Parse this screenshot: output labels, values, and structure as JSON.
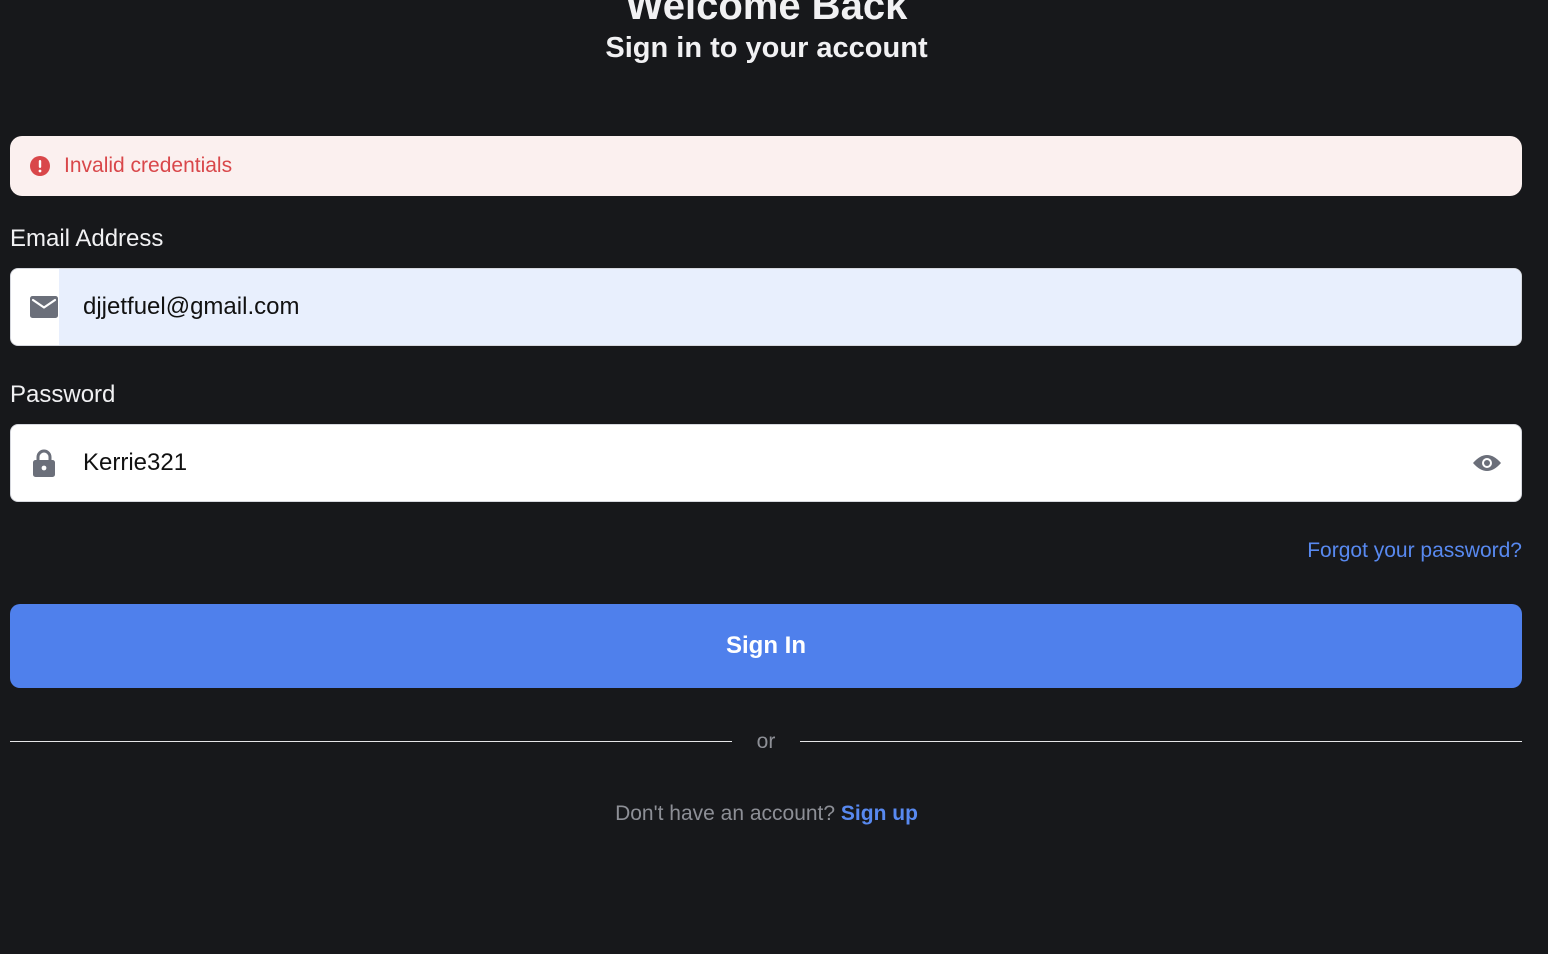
{
  "header": {
    "title": "Welcome Back",
    "subtitle": "Sign in to your account"
  },
  "alert": {
    "message": "Invalid credentials",
    "icon": "alert-circle-icon",
    "color": "#d9474a",
    "background": "#fbf0ef"
  },
  "email": {
    "label": "Email Address",
    "value": "djjetfuel@gmail.com",
    "icon": "mail-icon"
  },
  "password": {
    "label": "Password",
    "value": "Kerrie321",
    "icon": "lock-icon",
    "toggle_icon": "eye-icon"
  },
  "links": {
    "forgot_password": "Forgot your password?"
  },
  "signin": {
    "label": "Sign In",
    "color": "#4f80ec"
  },
  "divider": {
    "text": "or"
  },
  "signup": {
    "prompt": "Don't have an account? ",
    "link_label": "Sign up"
  },
  "colors": {
    "background": "#17181b",
    "accent": "#5889f0",
    "autofill": "#e8effd"
  }
}
